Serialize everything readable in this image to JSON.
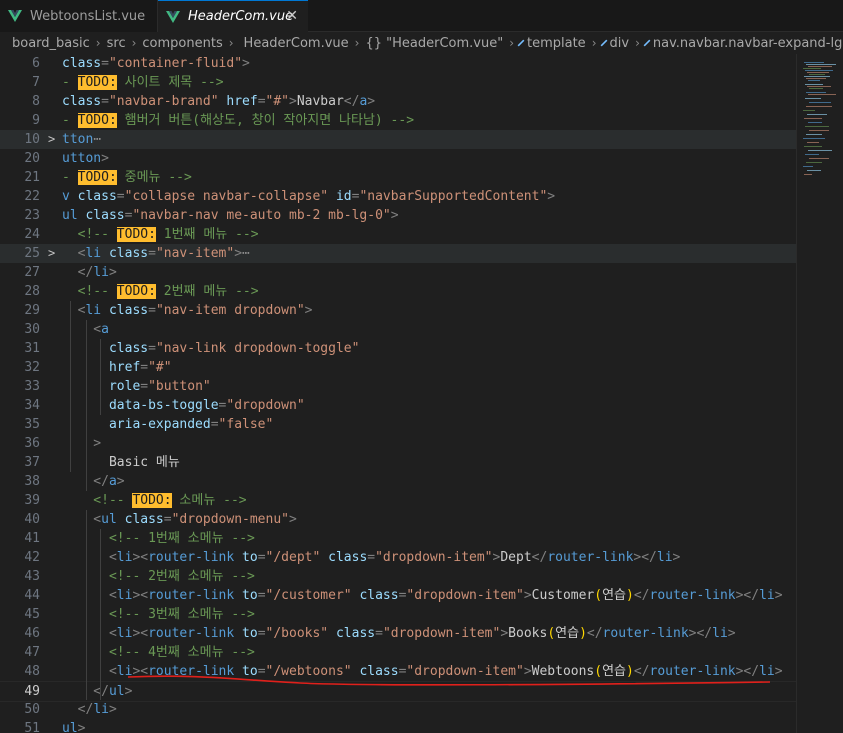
{
  "tabs": [
    {
      "label": "WebtoonsList.vue",
      "active": false
    },
    {
      "label": "HeaderCom.vue",
      "active": true,
      "close": "✕"
    }
  ],
  "breadcrumb": [
    "board_basic",
    "src",
    "components",
    "HeaderCom.vue",
    "{} \"HeaderCom.vue\"",
    "template",
    "div",
    "nav.navbar.navbar-expand-lg.bg-lig"
  ],
  "colors": {
    "vue": "#41b883",
    "todo": "#ffbd2e",
    "underline": "#e0201b",
    "accent": "#0078d4"
  },
  "editor": {
    "active_line": "49",
    "lines": [
      {
        "n": "6",
        "hl": false,
        "fold": "",
        "parts": [
          [
            "at",
            "class"
          ],
          [
            "tk",
            "="
          ],
          [
            "st",
            "\"container-fluid\""
          ],
          [
            "tk",
            ">"
          ]
        ]
      },
      {
        "n": "7",
        "hl": false,
        "fold": "",
        "parts": [
          [
            "cm",
            "- "
          ],
          [
            "todo",
            "TODO:"
          ],
          [
            "cm",
            " 사이트 제목 -->"
          ]
        ]
      },
      {
        "n": "8",
        "hl": false,
        "fold": "",
        "parts": [
          [
            "at",
            "class"
          ],
          [
            "tk",
            "="
          ],
          [
            "st",
            "\"navbar-brand\""
          ],
          [
            "tx",
            " "
          ],
          [
            "at",
            "href"
          ],
          [
            "tk",
            "="
          ],
          [
            "st",
            "\"#\""
          ],
          [
            "tk",
            ">"
          ],
          [
            "tx",
            "Navbar"
          ],
          [
            "tk",
            "</"
          ],
          [
            "tn",
            "a"
          ],
          [
            "tk",
            ">"
          ]
        ]
      },
      {
        "n": "9",
        "hl": false,
        "fold": "",
        "parts": [
          [
            "cm",
            "- "
          ],
          [
            "todo",
            "TODO:"
          ],
          [
            "cm",
            " 햄버거 버튼(해상도, 창이 작아지면 나타남) -->"
          ]
        ]
      },
      {
        "n": "10",
        "hl": true,
        "fold": ">",
        "parts": [
          [
            "tn",
            "tton"
          ],
          [
            "el",
            "⋯"
          ]
        ]
      },
      {
        "n": "20",
        "hl": false,
        "fold": "",
        "parts": [
          [
            "tn",
            "utton"
          ],
          [
            "tk",
            ">"
          ]
        ]
      },
      {
        "n": "21",
        "hl": false,
        "fold": "",
        "parts": [
          [
            "cm",
            "- "
          ],
          [
            "todo",
            "TODO:"
          ],
          [
            "cm",
            " 중메뉴 -->"
          ]
        ]
      },
      {
        "n": "22",
        "hl": false,
        "fold": "",
        "parts": [
          [
            "tn",
            "v"
          ],
          [
            "tx",
            " "
          ],
          [
            "at",
            "class"
          ],
          [
            "tk",
            "="
          ],
          [
            "st",
            "\"collapse navbar-collapse\""
          ],
          [
            "tx",
            " "
          ],
          [
            "at",
            "id"
          ],
          [
            "tk",
            "="
          ],
          [
            "st",
            "\"navbarSupportedContent\""
          ],
          [
            "tk",
            ">"
          ]
        ]
      },
      {
        "n": "23",
        "hl": false,
        "fold": "",
        "parts": [
          [
            "tn",
            "ul"
          ],
          [
            "tx",
            " "
          ],
          [
            "at",
            "class"
          ],
          [
            "tk",
            "="
          ],
          [
            "st",
            "\"navbar-nav me-auto mb-2 mb-lg-0\""
          ],
          [
            "tk",
            ">"
          ]
        ]
      },
      {
        "n": "24",
        "hl": false,
        "fold": "",
        "parts": [
          [
            "cm",
            "  <!-- "
          ],
          [
            "todo",
            "TODO:"
          ],
          [
            "cm",
            " 1번째 메뉴 -->"
          ]
        ]
      },
      {
        "n": "25",
        "hl": true,
        "fold": ">",
        "parts": [
          [
            "tk",
            "  <"
          ],
          [
            "tn",
            "li"
          ],
          [
            "tx",
            " "
          ],
          [
            "at",
            "class"
          ],
          [
            "tk",
            "="
          ],
          [
            "st",
            "\"nav-item\""
          ],
          [
            "tk",
            ">"
          ],
          [
            "el",
            "⋯"
          ]
        ]
      },
      {
        "n": "27",
        "hl": false,
        "fold": "",
        "parts": [
          [
            "tk",
            "  </"
          ],
          [
            "tn",
            "li"
          ],
          [
            "tk",
            ">"
          ]
        ]
      },
      {
        "n": "28",
        "hl": false,
        "fold": "",
        "parts": [
          [
            "cm",
            "  <!-- "
          ],
          [
            "todo",
            "TODO:"
          ],
          [
            "cm",
            " 2번째 메뉴 -->"
          ]
        ]
      },
      {
        "n": "29",
        "hl": false,
        "fold": "",
        "parts": [
          [
            "tk",
            "  <"
          ],
          [
            "tn",
            "li"
          ],
          [
            "tx",
            " "
          ],
          [
            "at",
            "class"
          ],
          [
            "tk",
            "="
          ],
          [
            "st",
            "\"nav-item dropdown\""
          ],
          [
            "tk",
            ">"
          ]
        ]
      },
      {
        "n": "30",
        "hl": false,
        "fold": "",
        "parts": [
          [
            "tk",
            "    <"
          ],
          [
            "tn",
            "a"
          ]
        ]
      },
      {
        "n": "31",
        "hl": false,
        "fold": "",
        "parts": [
          [
            "tx",
            "      "
          ],
          [
            "at",
            "class"
          ],
          [
            "tk",
            "="
          ],
          [
            "st",
            "\"nav-link dropdown-toggle\""
          ]
        ]
      },
      {
        "n": "32",
        "hl": false,
        "fold": "",
        "parts": [
          [
            "tx",
            "      "
          ],
          [
            "at",
            "href"
          ],
          [
            "tk",
            "="
          ],
          [
            "st",
            "\"#\""
          ]
        ]
      },
      {
        "n": "33",
        "hl": false,
        "fold": "",
        "parts": [
          [
            "tx",
            "      "
          ],
          [
            "at",
            "role"
          ],
          [
            "tk",
            "="
          ],
          [
            "st",
            "\"button\""
          ]
        ]
      },
      {
        "n": "34",
        "hl": false,
        "fold": "",
        "parts": [
          [
            "tx",
            "      "
          ],
          [
            "at",
            "data-bs-toggle"
          ],
          [
            "tk",
            "="
          ],
          [
            "st",
            "\"dropdown\""
          ]
        ]
      },
      {
        "n": "35",
        "hl": false,
        "fold": "",
        "parts": [
          [
            "tx",
            "      "
          ],
          [
            "at",
            "aria-expanded"
          ],
          [
            "tk",
            "="
          ],
          [
            "st",
            "\"false\""
          ]
        ]
      },
      {
        "n": "36",
        "hl": false,
        "fold": "",
        "parts": [
          [
            "tk",
            "    >"
          ]
        ]
      },
      {
        "n": "37",
        "hl": false,
        "fold": "",
        "parts": [
          [
            "tx",
            "      Basic 메뉴"
          ]
        ]
      },
      {
        "n": "38",
        "hl": false,
        "fold": "",
        "parts": [
          [
            "tk",
            "    </"
          ],
          [
            "tn",
            "a"
          ],
          [
            "tk",
            ">"
          ]
        ]
      },
      {
        "n": "39",
        "hl": false,
        "fold": "",
        "parts": [
          [
            "cm",
            "    <!-- "
          ],
          [
            "todo",
            "TODO:"
          ],
          [
            "cm",
            " 소메뉴 -->"
          ]
        ]
      },
      {
        "n": "40",
        "hl": false,
        "fold": "",
        "parts": [
          [
            "tk",
            "    <"
          ],
          [
            "tn",
            "ul"
          ],
          [
            "tx",
            " "
          ],
          [
            "at",
            "class"
          ],
          [
            "tk",
            "="
          ],
          [
            "st",
            "\"dropdown-menu\""
          ],
          [
            "tk",
            ">"
          ]
        ]
      },
      {
        "n": "41",
        "hl": false,
        "fold": "",
        "parts": [
          [
            "cm",
            "      <!-- 1번째 소메뉴 -->"
          ]
        ]
      },
      {
        "n": "42",
        "hl": false,
        "fold": "",
        "parts": [
          [
            "tk",
            "      <"
          ],
          [
            "tn",
            "li"
          ],
          [
            "tk",
            "><"
          ],
          [
            "tn",
            "router-link"
          ],
          [
            "tx",
            " "
          ],
          [
            "at",
            "to"
          ],
          [
            "tk",
            "="
          ],
          [
            "st",
            "\"/dept\""
          ],
          [
            "tx",
            " "
          ],
          [
            "at",
            "class"
          ],
          [
            "tk",
            "="
          ],
          [
            "st",
            "\"dropdown-item\""
          ],
          [
            "tk",
            ">"
          ],
          [
            "tx",
            "Dept"
          ],
          [
            "tk",
            "</"
          ],
          [
            "tn",
            "router-link"
          ],
          [
            "tk",
            "></"
          ],
          [
            "tn",
            "li"
          ],
          [
            "tk",
            ">"
          ]
        ]
      },
      {
        "n": "43",
        "hl": false,
        "fold": "",
        "parts": [
          [
            "cm",
            "      <!-- 2번째 소메뉴 -->"
          ]
        ]
      },
      {
        "n": "44",
        "hl": false,
        "fold": "",
        "parts": [
          [
            "tk",
            "      <"
          ],
          [
            "tn",
            "li"
          ],
          [
            "tk",
            "><"
          ],
          [
            "tn",
            "router-link"
          ],
          [
            "tx",
            " "
          ],
          [
            "at",
            "to"
          ],
          [
            "tk",
            "="
          ],
          [
            "st",
            "\"/customer\""
          ],
          [
            "tx",
            " "
          ],
          [
            "at",
            "class"
          ],
          [
            "tk",
            "="
          ],
          [
            "st",
            "\"dropdown-item\""
          ],
          [
            "tk",
            ">"
          ],
          [
            "tx",
            "Customer"
          ],
          [
            "br",
            "("
          ],
          [
            "tx",
            "연습"
          ],
          [
            "br",
            ")"
          ],
          [
            "tk",
            "</"
          ],
          [
            "tn",
            "router-link"
          ],
          [
            "tk",
            "></"
          ],
          [
            "tn",
            "li"
          ],
          [
            "tk",
            ">"
          ]
        ]
      },
      {
        "n": "45",
        "hl": false,
        "fold": "",
        "parts": [
          [
            "cm",
            "      <!-- 3번째 소메뉴 -->"
          ]
        ]
      },
      {
        "n": "46",
        "hl": false,
        "fold": "",
        "parts": [
          [
            "tk",
            "      <"
          ],
          [
            "tn",
            "li"
          ],
          [
            "tk",
            "><"
          ],
          [
            "tn",
            "router-link"
          ],
          [
            "tx",
            " "
          ],
          [
            "at",
            "to"
          ],
          [
            "tk",
            "="
          ],
          [
            "st",
            "\"/books\""
          ],
          [
            "tx",
            " "
          ],
          [
            "at",
            "class"
          ],
          [
            "tk",
            "="
          ],
          [
            "st",
            "\"dropdown-item\""
          ],
          [
            "tk",
            ">"
          ],
          [
            "tx",
            "Books"
          ],
          [
            "br",
            "("
          ],
          [
            "tx",
            "연습"
          ],
          [
            "br",
            ")"
          ],
          [
            "tk",
            "</"
          ],
          [
            "tn",
            "router-link"
          ],
          [
            "tk",
            "></"
          ],
          [
            "tn",
            "li"
          ],
          [
            "tk",
            ">"
          ]
        ]
      },
      {
        "n": "47",
        "hl": false,
        "fold": "",
        "parts": [
          [
            "cm",
            "      <!-- 4번째 소메뉴 -->"
          ]
        ]
      },
      {
        "n": "48",
        "hl": false,
        "fold": "",
        "parts": [
          [
            "tk",
            "      <"
          ],
          [
            "tn",
            "li"
          ],
          [
            "tk",
            "><"
          ],
          [
            "tn",
            "router-link"
          ],
          [
            "tx",
            " "
          ],
          [
            "at",
            "to"
          ],
          [
            "tk",
            "="
          ],
          [
            "st",
            "\"/webtoons\""
          ],
          [
            "tx",
            " "
          ],
          [
            "at",
            "class"
          ],
          [
            "tk",
            "="
          ],
          [
            "st",
            "\"dropdown-item\""
          ],
          [
            "tk",
            ">"
          ],
          [
            "tx",
            "Webtoons"
          ],
          [
            "br",
            "("
          ],
          [
            "tx",
            "연습"
          ],
          [
            "br",
            ")"
          ],
          [
            "tk",
            "</"
          ],
          [
            "tn",
            "router-link"
          ],
          [
            "tk",
            "></"
          ],
          [
            "tn",
            "li"
          ],
          [
            "tk",
            ">"
          ]
        ]
      },
      {
        "n": "49",
        "hl": false,
        "fold": "",
        "parts": [
          [
            "tk",
            "    </"
          ],
          [
            "tn",
            "ul"
          ],
          [
            "tk",
            ">"
          ]
        ]
      },
      {
        "n": "50",
        "hl": false,
        "fold": "",
        "parts": [
          [
            "tk",
            "  </"
          ],
          [
            "tn",
            "li"
          ],
          [
            "tk",
            ">"
          ]
        ]
      },
      {
        "n": "51",
        "hl": false,
        "fold": "",
        "parts": [
          [
            "tn",
            "ul"
          ],
          [
            "tk",
            ">"
          ]
        ]
      }
    ]
  }
}
